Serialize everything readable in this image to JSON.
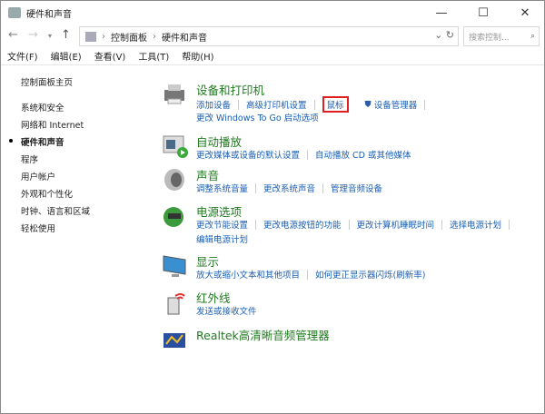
{
  "window": {
    "title": "硬件和声音",
    "minimize": "—",
    "maximize": "☐",
    "close": "✕"
  },
  "address": {
    "crumbs": [
      "控制面板",
      "硬件和声音"
    ],
    "search_placeholder": "搜索控制..."
  },
  "menu": [
    "文件(F)",
    "编辑(E)",
    "查看(V)",
    "工具(T)",
    "帮助(H)"
  ],
  "sidebar": {
    "home": "控制面板主页",
    "items": [
      "系统和安全",
      "网络和 Internet",
      "硬件和声音",
      "程序",
      "用户帐户",
      "外观和个性化",
      "时钟、语言和区域",
      "轻松使用"
    ],
    "current": "硬件和声音"
  },
  "sections": [
    {
      "title": "设备和打印机",
      "links": [
        [
          "添加设备",
          "高级打印机设置",
          "鼠标",
          "设备管理器"
        ],
        [
          "更改 Windows To Go 启动选项"
        ]
      ]
    },
    {
      "title": "自动播放",
      "links": [
        [
          "更改媒体或设备的默认设置",
          "自动播放 CD 或其他媒体"
        ]
      ]
    },
    {
      "title": "声音",
      "links": [
        [
          "调整系统音量",
          "更改系统声音",
          "管理音频设备"
        ]
      ]
    },
    {
      "title": "电源选项",
      "links": [
        [
          "更改节能设置",
          "更改电源按钮的功能",
          "更改计算机睡眠时间",
          "选择电源计划"
        ],
        [
          "编辑电源计划"
        ]
      ]
    },
    {
      "title": "显示",
      "links": [
        [
          "放大或缩小文本和其他项目",
          "如何更正显示器闪烁(刷新率)"
        ]
      ]
    },
    {
      "title": "红外线",
      "links": [
        [
          "发送或接收文件"
        ]
      ]
    },
    {
      "title": "Realtek高清晰音频管理器",
      "links": []
    }
  ]
}
